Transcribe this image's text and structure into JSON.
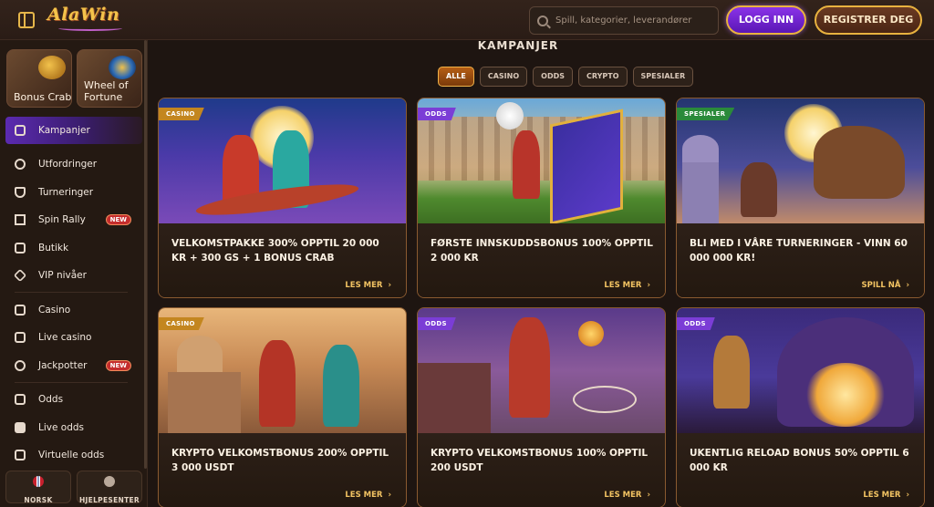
{
  "header": {
    "logo_text": "AlaWin",
    "search_placeholder": "Spill, kategorier, leverandører",
    "login_label": "LOGG INN",
    "register_label": "REGISTRER DEG"
  },
  "sidebar": {
    "promo_tiles": [
      {
        "label": "Bonus Crab"
      },
      {
        "label": "Wheel of Fortune"
      }
    ],
    "items": [
      {
        "label": "Kampanjer",
        "icon": "gift-icon",
        "active": true
      },
      {
        "label": "Utfordringer",
        "icon": "medal-icon"
      },
      {
        "label": "Turneringer",
        "icon": "trophy-icon"
      },
      {
        "label": "Spin Rally",
        "icon": "flag-icon",
        "badge": "NEW"
      },
      {
        "label": "Butikk",
        "icon": "shop-icon"
      },
      {
        "label": "VIP nivåer",
        "icon": "diamond-icon"
      },
      {
        "label": "Casino",
        "icon": "slot-machine-icon"
      },
      {
        "label": "Live casino",
        "icon": "cards-icon"
      },
      {
        "label": "Jackpotter",
        "icon": "clover-icon",
        "badge": "NEW"
      },
      {
        "label": "Odds",
        "icon": "ticket-icon"
      },
      {
        "label": "Live odds",
        "icon": "live-icon"
      },
      {
        "label": "Virtuelle odds",
        "icon": "virtual-icon"
      }
    ],
    "footer": {
      "language_label": "NORSK",
      "help_label": "HJELPESENTER"
    }
  },
  "main": {
    "title": "KAMPANJER",
    "filters": [
      "ALLE",
      "CASINO",
      "ODDS",
      "CRYPTO",
      "SPESIALER"
    ],
    "active_filter": "ALLE",
    "cards": [
      {
        "tag": "CASINO",
        "title": "VELKOMSTPAKKE 300% OPPTIL 20 000 KR + 300 GS + 1 BONUS CRAB",
        "cta": "LES MER"
      },
      {
        "tag": "ODDS",
        "title": "FØRSTE INNSKUDDSBONUS 100% OPPTIL 2 000 KR",
        "cta": "LES MER"
      },
      {
        "tag": "SPESIALER",
        "title": "BLI MED I VÅRE TURNERINGER - VINN 60 000 000 KR!",
        "cta": "SPILL NÅ"
      },
      {
        "tag": "CASINO",
        "title": "KRYPTO VELKOMSTBONUS 200% OPPTIL 3 000 USDT",
        "cta": "LES MER"
      },
      {
        "tag": "ODDS",
        "title": "KRYPTO VELKOMSTBONUS 100% OPPTIL 200 USDT",
        "cta": "LES MER"
      },
      {
        "tag": "ODDS",
        "title": "UKENTLIG RELOAD BONUS 50% OPPTIL 6 000 KR",
        "cta": "LES MER"
      }
    ]
  },
  "colors": {
    "accent_gold": "#e8b23f",
    "login_purple": "#7a2de0",
    "active_nav": "#5b2ab0",
    "badge_red": "#c42d2d"
  }
}
